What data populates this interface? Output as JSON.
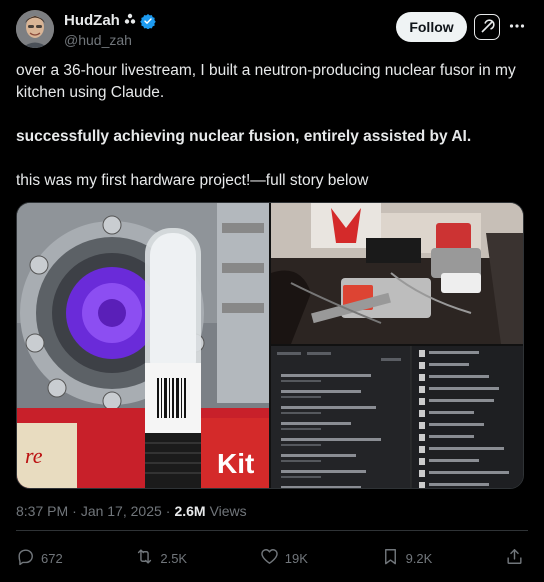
{
  "author": {
    "name": "HudZah",
    "affiliate_icon": "affiliate-badge-icon",
    "verified_icon": "verified-badge-icon",
    "handle": "@hud_zah",
    "avatar_icon": "avatar"
  },
  "header_actions": {
    "follow_label": "Follow",
    "grok_icon": "grok-icon",
    "more_icon": "more-icon"
  },
  "tweet": {
    "line1": "over a 36-hour livestream, I built a neutron-producing nuclear fusor in my kitchen using Claude.",
    "line2": "successfully achieving nuclear fusion, entirely assisted by AI.",
    "line3": "this was my first hardware project!—full story below"
  },
  "media": [
    {
      "icon": "fusor-chamber-photo"
    },
    {
      "icon": "kitchen-table-setup-photo"
    },
    {
      "icon": "chat-history-screenshot"
    }
  ],
  "meta": {
    "time": "8:37 PM",
    "date": "Jan 17, 2025",
    "separator": "·",
    "views_count": "2.6M",
    "views_label": "Views"
  },
  "actions": {
    "replies": "672",
    "reposts": "2.5K",
    "likes": "19K",
    "bookmarks": "9.2K"
  },
  "colors": {
    "background": "#000000",
    "text": "#e7e9ea",
    "muted": "#71767b",
    "verified": "#1d9bf0",
    "follow_bg": "#eff3f4"
  }
}
